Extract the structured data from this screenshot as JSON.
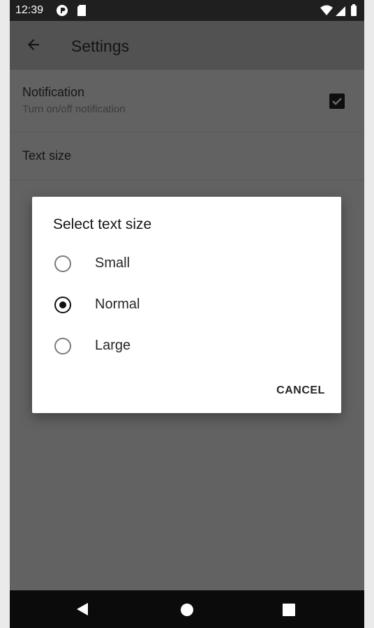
{
  "status_bar": {
    "time": "12:39",
    "icons": [
      "app-notification-icon",
      "sd-card-icon",
      "wifi-icon",
      "cell-signal-icon",
      "battery-icon"
    ]
  },
  "app_bar": {
    "title": "Settings",
    "back_icon": "arrow-back-icon"
  },
  "settings": {
    "notification": {
      "title": "Notification",
      "subtitle": "Turn on/off notification",
      "checked": true
    },
    "text_size": {
      "title": "Text size"
    }
  },
  "dialog": {
    "title": "Select text size",
    "options": [
      {
        "label": "Small",
        "selected": false
      },
      {
        "label": "Normal",
        "selected": true
      },
      {
        "label": "Large",
        "selected": false
      }
    ],
    "cancel_label": "CANCEL"
  },
  "nav_bar": {
    "icons": [
      "back-triangle-icon",
      "home-circle-icon",
      "recents-square-icon"
    ]
  },
  "colors": {
    "scrim": "#626262",
    "dialog_bg": "#ffffff",
    "status_bar": "#1f1f1f",
    "nav_bar": "#0b0b0b"
  }
}
